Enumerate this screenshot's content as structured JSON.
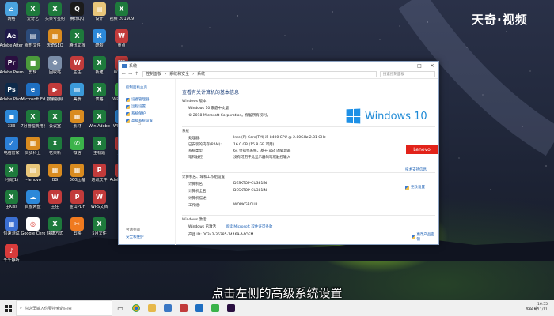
{
  "watermark": "天奇·视频",
  "subtitle": "点击左侧的高级系统设置",
  "desktop_icons": [
    {
      "label": "网络",
      "color": "#4aa3df",
      "glyph": "⌂"
    },
    {
      "label": "Adobe After Effects CC ...",
      "color": "#1f1a4a",
      "glyph": "Ae"
    },
    {
      "label": "Adobe Premiere P...",
      "color": "#2a0f40",
      "glyph": "Pr"
    },
    {
      "label": "Adobe Photosh...",
      "color": "#0e2a4a",
      "glyph": "Ps"
    },
    {
      "label": "333",
      "color": "#2c88d9",
      "glyph": "▣"
    },
    {
      "label": "电脑管家",
      "color": "#2b7fd6",
      "glyph": "✓"
    },
    {
      "label": "利润(1)",
      "color": "#1e7a3c",
      "glyph": "X"
    },
    {
      "label": "主Kiss",
      "color": "#1e7a3c",
      "glyph": "X"
    },
    {
      "label": "快速测试",
      "color": "#3b6fd1",
      "glyph": "▦"
    },
    {
      "label": "千千静听",
      "color": "#d83b3b",
      "glyph": "♪"
    },
    {
      "label": "爱奇艺",
      "color": "#1e7a3c",
      "glyph": "X"
    },
    {
      "label": "图形文件",
      "color": "#2c4b7a",
      "glyph": "▤"
    },
    {
      "label": "剪辑",
      "color": "#4b9a3b",
      "glyph": "■"
    },
    {
      "label": "Microsoft Edge",
      "color": "#1f6fc1",
      "glyph": "e"
    },
    {
      "label": "7月管理费用明细",
      "color": "#1e7a3c",
      "glyph": "X"
    },
    {
      "label": "同步科上",
      "color": "#d98b1f",
      "glyph": "▦"
    },
    {
      "label": "~lenovo",
      "color": "#e8c67a",
      "glyph": "▤"
    },
    {
      "label": "百度网盘",
      "color": "#2c88d9",
      "glyph": "☁"
    },
    {
      "label": "Google Chrome",
      "color": "#ffffff",
      "glyph": "◎"
    },
    {
      "label": "头条号签约",
      "color": "#1e7a3c",
      "glyph": "X"
    },
    {
      "label": "天奇SEO",
      "color": "#d98b1f",
      "glyph": "▦"
    },
    {
      "label": "回收站",
      "color": "#7a8da8",
      "glyph": "♻"
    },
    {
      "label": "搜索视频",
      "color": "#c23b3b",
      "glyph": "▶"
    },
    {
      "label": "会议室",
      "color": "#1e7a3c",
      "glyph": "X"
    },
    {
      "label": "花果新",
      "color": "#1e7a3c",
      "glyph": "X"
    },
    {
      "label": "BG",
      "color": "#d98b1f",
      "glyph": "▦"
    },
    {
      "label": "主任",
      "color": "#c23b3b",
      "glyph": "W"
    },
    {
      "label": "快捷方式",
      "color": "#1e7a3c",
      "glyph": "X"
    },
    {
      "label": "腾讯QQ",
      "color": "#1b1b1b",
      "glyph": "Q"
    },
    {
      "label": "腾讯文档",
      "color": "#1e7a3c",
      "glyph": "X"
    },
    {
      "label": "主任",
      "color": "#c23b3b",
      "glyph": "W"
    },
    {
      "label": "美食",
      "color": "#3b9ad9",
      "glyph": "▤"
    },
    {
      "label": "素材",
      "color": "#d98b1f",
      "glyph": "▦"
    },
    {
      "label": "微信",
      "color": "#3bb34a",
      "glyph": "✆"
    },
    {
      "label": "360压缩",
      "color": "#d98b1f",
      "glyph": "▦"
    },
    {
      "label": "金山PDF",
      "color": "#c23b3b",
      "glyph": "P"
    },
    {
      "label": "剪映",
      "color": "#f07a1f",
      "glyph": "✂"
    },
    {
      "label": "设计",
      "color": "#e8c67a",
      "glyph": "▤"
    },
    {
      "label": "酷狗",
      "color": "#2c88d9",
      "glyph": "K"
    },
    {
      "label": "新建",
      "color": "#1e7a3c",
      "glyph": "X"
    },
    {
      "label": "表格",
      "color": "#1e7a3c",
      "glyph": "X"
    },
    {
      "label": "Win Adobe",
      "color": "#1e7a3c",
      "glyph": "X"
    },
    {
      "label": "主标题",
      "color": "#1e7a3c",
      "glyph": "X"
    },
    {
      "label": "通讯文件",
      "color": "#c23b3b",
      "glyph": "P"
    },
    {
      "label": "WPS文档",
      "color": "#c23b3b",
      "glyph": "W"
    },
    {
      "label": "5月文件",
      "color": "#1e7a3c",
      "glyph": "X"
    },
    {
      "label": "视频 2019091",
      "color": "#1e7a3c",
      "glyph": "X"
    },
    {
      "label": "重点",
      "color": "#c23b3b",
      "glyph": "W"
    },
    {
      "label": "WPS H5",
      "color": "#c23b3b",
      "glyph": "W"
    },
    {
      "label": "WPS PDF",
      "color": "#3bb34a",
      "glyph": "W"
    },
    {
      "label": "WPS文字",
      "color": "#2c88d9",
      "glyph": "W"
    },
    {
      "label": "主任",
      "color": "#c23b3b",
      "glyph": "W"
    },
    {
      "label": "Adobe Creati...",
      "color": "#c23b3b",
      "glyph": "◉"
    }
  ],
  "window": {
    "title": "系统",
    "buttons": {
      "min": "—",
      "max": "□",
      "close": "✕"
    },
    "address": [
      "控制面板",
      "系统和安全",
      "系统"
    ],
    "search_placeholder": "搜索控制面板",
    "sidebar": {
      "home": "控制面板主页",
      "links": [
        "设备管理器",
        "远程设置",
        "系统保护",
        "高级系统设置"
      ],
      "see_also": "另请参阅",
      "see_also_link": "安全和维护"
    },
    "heading": "查看有关计算机的基本信息",
    "edition_section": "Windows 版本",
    "edition": "Windows 10 家庭中文版",
    "copyright": "© 2018 Microsoft Corporation。保留所有权利。",
    "windows_logo_text": "Windows 10",
    "system_section": "系统",
    "system_rows": [
      {
        "label": "处理器:",
        "value": "Intel(R) Core(TM) i5-8400 CPU @ 2.80GHz   2.81 GHz"
      },
      {
        "label": "已安装的内存(RAM):",
        "value": "16.0 GB (15.8 GB 可用)"
      },
      {
        "label": "系统类型:",
        "value": "64 位操作系统，基于 x64 的处理器"
      },
      {
        "label": "笔和触控:",
        "value": "没有可用于此显示器的笔或触控输入"
      }
    ],
    "lenovo_text": "Lenovo",
    "support_link": "技术支持信息",
    "computer_section": "计算机名、域和工作组设置",
    "computer_rows": [
      {
        "label": "计算机名:",
        "value": "DESKTOP-CU381IN"
      },
      {
        "label": "计算机全名:",
        "value": "DESKTOP-CU381IN"
      },
      {
        "label": "计算机描述:",
        "value": ""
      },
      {
        "label": "工作组:",
        "value": "WORKGROUP"
      }
    ],
    "change_settings": "更改设置",
    "activation_section": "Windows 激活",
    "activation_status": "Windows 已激活",
    "license_link": "阅读 Microsoft 软件许可条款",
    "product_id": "产品 ID: 00342-35285-14469-AAOEM",
    "change_key": "更改产品密钥"
  },
  "taskbar": {
    "search_placeholder": "在这里输入你要搜索的内容",
    "clock_time": "16:55",
    "clock_date": "2019/11/11",
    "tray_text": "∧  ⊡  中"
  },
  "colors": {
    "accent": "#1a5fb4",
    "lenovo": "#e2231a",
    "windows_blue": "#1e8ad6"
  }
}
